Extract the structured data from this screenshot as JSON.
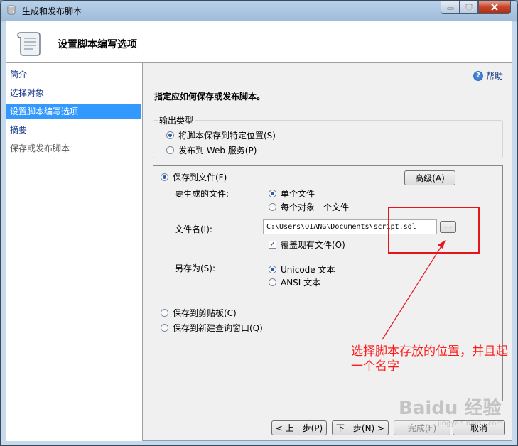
{
  "window": {
    "title": "生成和发布脚本"
  },
  "header": {
    "title": "设置脚本编写选项"
  },
  "nav": {
    "items": [
      {
        "label": "简介"
      },
      {
        "label": "选择对象"
      },
      {
        "label": "设置脚本编写选项"
      },
      {
        "label": "摘要"
      },
      {
        "label": "保存或发布脚本"
      }
    ]
  },
  "help": {
    "label": "帮助"
  },
  "main": {
    "instruction": "指定应如何保存或发布脚本。",
    "output_group": {
      "label": "输出类型",
      "opt_save_location": "将脚本保存到特定位置(S)",
      "opt_publish_web": "发布到 Web 服务(P)"
    },
    "save_to_file": "保存到文件(F)",
    "advanced_button": "高级(A)",
    "files_label": "要生成的文件:",
    "opt_single_file": "单个文件",
    "opt_file_per_object": "每个对象一个文件",
    "filename_label": "文件名(I):",
    "filename_value": "C:\\Users\\QIANG\\Documents\\script.sql",
    "browse_label": "...",
    "overwrite_label": "覆盖现有文件(O)",
    "save_as_label": "另存为(S):",
    "opt_unicode": "Unicode 文本",
    "opt_ansi": "ANSI 文本",
    "save_clipboard": "保存到剪贴板(C)",
    "save_new_query": "保存到新建查询窗口(Q)"
  },
  "footer": {
    "prev": "< 上一步(P)",
    "next": "下一步(N) >",
    "finish": "完成(F)",
    "cancel": "取消"
  },
  "annotation": {
    "text": "选择脚本存放的位置，并且起一个名字"
  },
  "watermark": {
    "text": "Baidu 经验",
    "sub": "jingyan.baidu.com"
  },
  "colors": {
    "selection": "#3399ff",
    "annotation": "#e8141b",
    "link": "#1a3a8c"
  }
}
